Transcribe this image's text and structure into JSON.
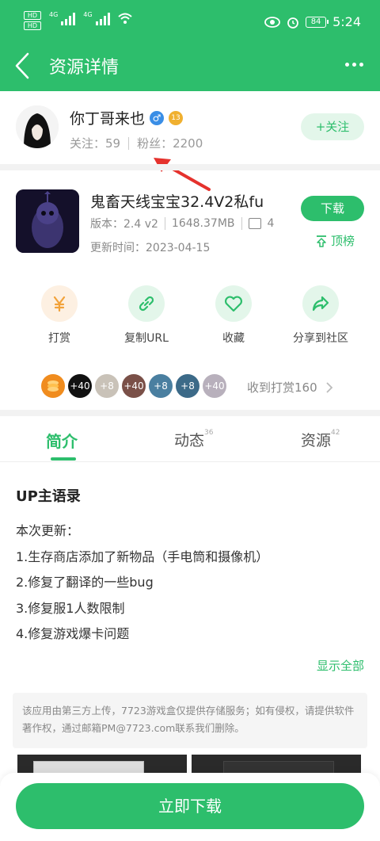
{
  "status_bar": {
    "hd1": "HD",
    "hd2": "HD",
    "sig1_label": "4G",
    "sig2_label": "4G",
    "battery": "84",
    "time": "5:24"
  },
  "header": {
    "title": "资源详情",
    "accent_color": "#2dbe6c"
  },
  "user": {
    "name": "你丁哥来也",
    "gender_symbol": "♂",
    "level": "13",
    "following": "关注：59",
    "fans": "粉丝：2200",
    "follow_label": "+关注"
  },
  "app": {
    "name": "鬼畜天线宝宝32.4V2私fu",
    "version": "版本：2.4 v2",
    "size": "1648.37MB",
    "screens_count": "4",
    "update_time": "更新时间：2023-04-15",
    "download_label": "下载",
    "top_label": "顶榜"
  },
  "actions": [
    {
      "label": "打赏",
      "icon": "yen-icon"
    },
    {
      "label": "复制URL",
      "icon": "link-icon"
    },
    {
      "label": "收藏",
      "icon": "heart-icon"
    },
    {
      "label": "分享到社区",
      "icon": "share-icon"
    }
  ],
  "tips": {
    "badges": [
      "+40",
      "+8",
      "+40",
      "+8",
      "+8",
      "+40"
    ],
    "summary": "收到打赏160"
  },
  "tabs": [
    {
      "label": "简介",
      "count": ""
    },
    {
      "label": "动态",
      "count": "36"
    },
    {
      "label": "资源",
      "count": "42"
    }
  ],
  "intro": {
    "section_title": "UP主语录",
    "lines": [
      "本次更新：",
      "1.生存商店添加了新物品（手电筒和摄像机）",
      "2.修复了翻译的一些bug",
      "3.修复服1人数限制",
      "4.修复游戏爆卡问题"
    ],
    "show_all": "显示全部"
  },
  "disclaimer": "该应用由第三方上传，7723游戏盒仅提供存储服务；如有侵权，请提供软件著作权，通过邮箱PM@7723.com联系我们删除。",
  "bottom": {
    "download_now": "立即下载"
  }
}
